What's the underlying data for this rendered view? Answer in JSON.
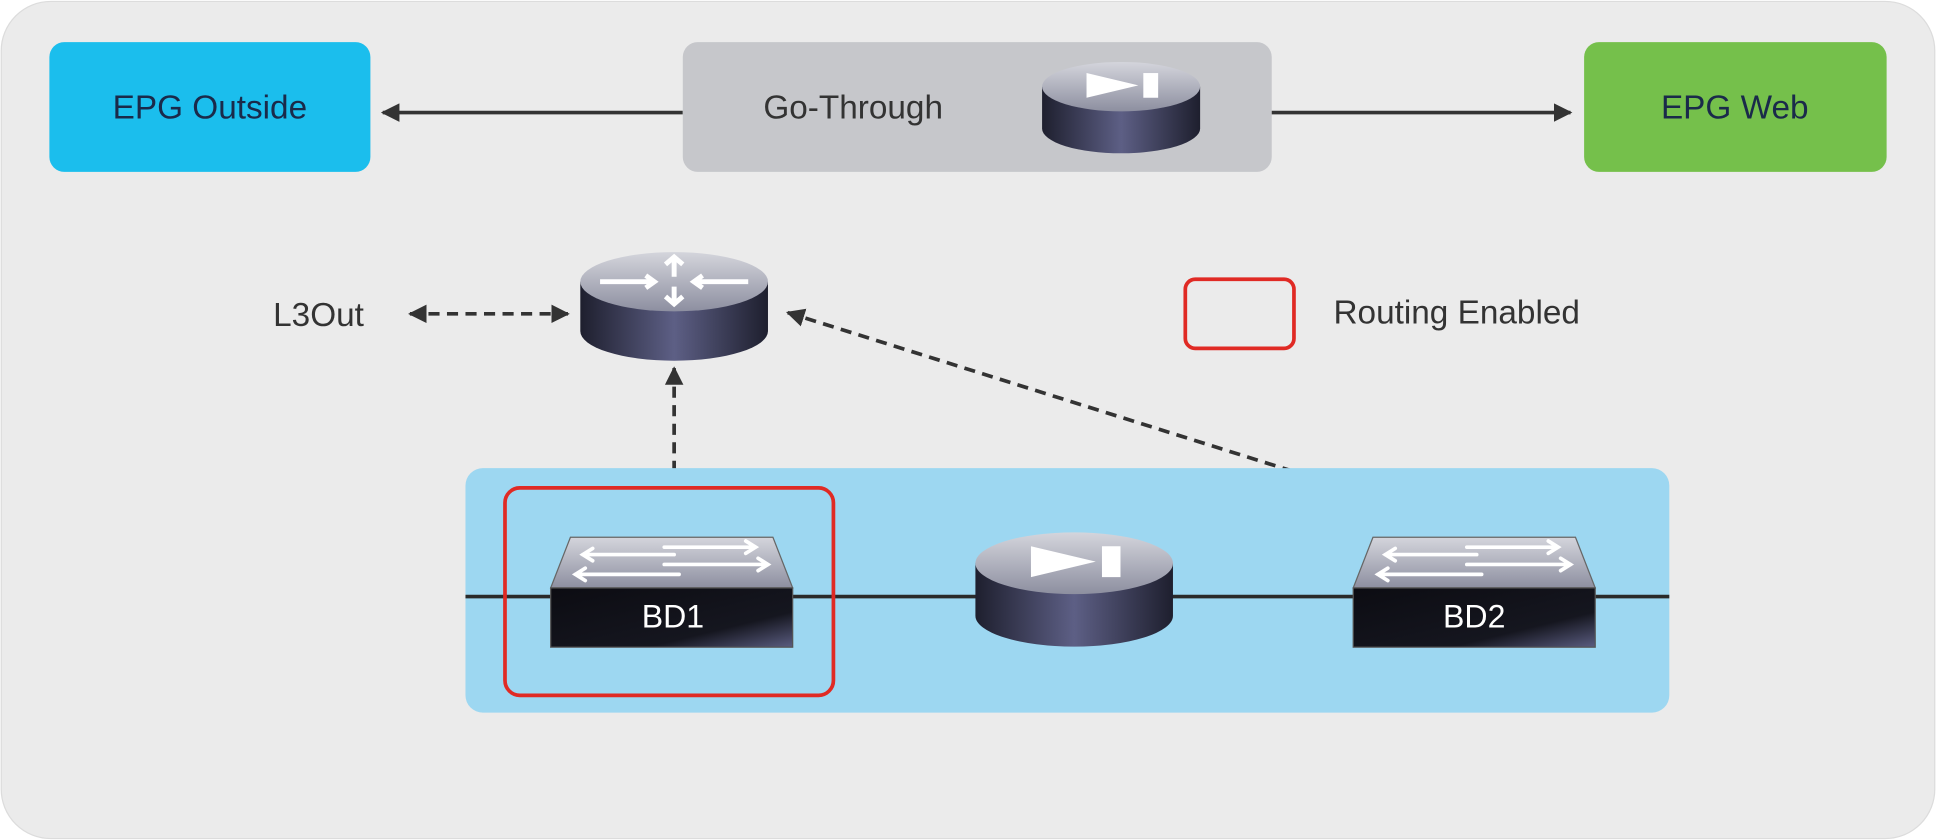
{
  "epg_outside": {
    "label": "EPG Outside",
    "color": "#1bbeed"
  },
  "go_through": {
    "label": "Go-Through",
    "color": "#c6c7cb"
  },
  "epg_web": {
    "label": "EPG Web",
    "color": "#75c04b"
  },
  "l3out": {
    "label": "L3Out"
  },
  "legend": {
    "label": "Routing Enabled",
    "color": "#e02a24"
  },
  "bridge_domain_area": {
    "color": "#9dd7f1"
  },
  "bd1": {
    "label": "BD1"
  },
  "bd2": {
    "label": "BD2"
  },
  "icons": {
    "service_device": "service-node-icon",
    "router": "router-icon",
    "switch": "switch-icon"
  }
}
